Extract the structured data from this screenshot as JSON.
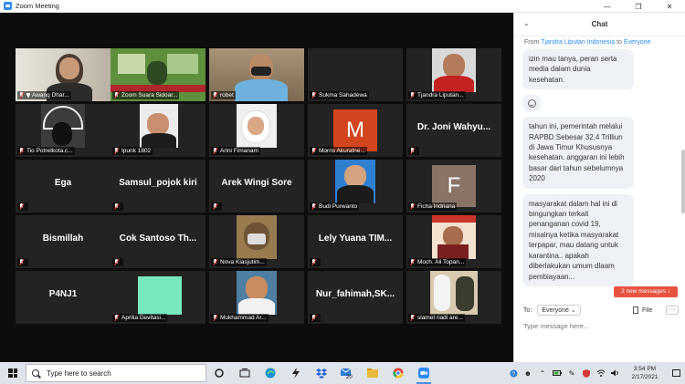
{
  "window": {
    "title": "Zoom Meeting"
  },
  "gallery": {
    "tiles": [
      {
        "name": "Awang Dhar...",
        "big": "",
        "pin": true
      },
      {
        "name": "Zoom Suara Sidoar...",
        "big": "",
        "active": true
      },
      {
        "name": "robet",
        "big": ""
      },
      {
        "name": "Sukma Sahadewa",
        "big": ""
      },
      {
        "name": "Tjandra Liputan...",
        "big": ""
      },
      {
        "name": "Tio Potretkota.c...",
        "big": ""
      },
      {
        "name": "Ipunk 1802",
        "big": ""
      },
      {
        "name": "Arini Fimanam",
        "big": ""
      },
      {
        "name": "Morris Akuratne...",
        "big": "",
        "avatar": "M"
      },
      {
        "name": "",
        "big": "Dr. Joni Wahyu..."
      },
      {
        "name": "",
        "big": "Ega"
      },
      {
        "name": "",
        "big": "Samsul_pojok kiri"
      },
      {
        "name": "",
        "big": "Arek Wingi Sore"
      },
      {
        "name": "Budi Purwanto",
        "big": ""
      },
      {
        "name": "Ficha Indriana",
        "big": "",
        "avatar": "F"
      },
      {
        "name": "",
        "big": "Bismillah"
      },
      {
        "name": "",
        "big": "Cok Santoso Th..."
      },
      {
        "name": "Nova Kiasjutim...",
        "big": ""
      },
      {
        "name": "",
        "big": "Lely Yuana TIM..."
      },
      {
        "name": "Moch. Ali Topan...",
        "big": ""
      },
      {
        "name": "",
        "big": "P4NJ1"
      },
      {
        "name": "Aprilia Devitasi...",
        "big": ""
      },
      {
        "name": "Mukhammad Ar...",
        "big": ""
      },
      {
        "name": "",
        "big": "Nur_fahimah,SK..."
      },
      {
        "name": "slamet riadi are...",
        "big": ""
      }
    ]
  },
  "chat": {
    "title": "Chat",
    "from_prefix": "From",
    "from_name": "Tjandra Liputan Indonesia",
    "to_word": "to",
    "to_name": "Everyone",
    "messages": [
      "izin mau tanya, peran serta media dalam dunia kesehatan.",
      "tahun ini, pemerintah melalui RAPBD Sebesar  32,4 Trilliun di Jawa Timur Khususnya kesehatan. anggaran ini lebih basar dari tahun sebelumnya 2020",
      "masyarakat dalam hal ini di bingungkan terkait penanganan covid 19, misalnya ketika masyarakat terpapar, mau datang untuk karantina.. apakah diberlakukan umum dlaam pembiayaan..."
    ],
    "new_messages": "2 new messages",
    "to_label": "To:",
    "recipient": "Everyone",
    "file_label": "File",
    "more": "···",
    "input_placeholder": "Type message here..."
  },
  "taskbar": {
    "search_placeholder": "Type here to search",
    "badge": "20",
    "time": "3:54 PM",
    "date": "2/17/2021"
  }
}
